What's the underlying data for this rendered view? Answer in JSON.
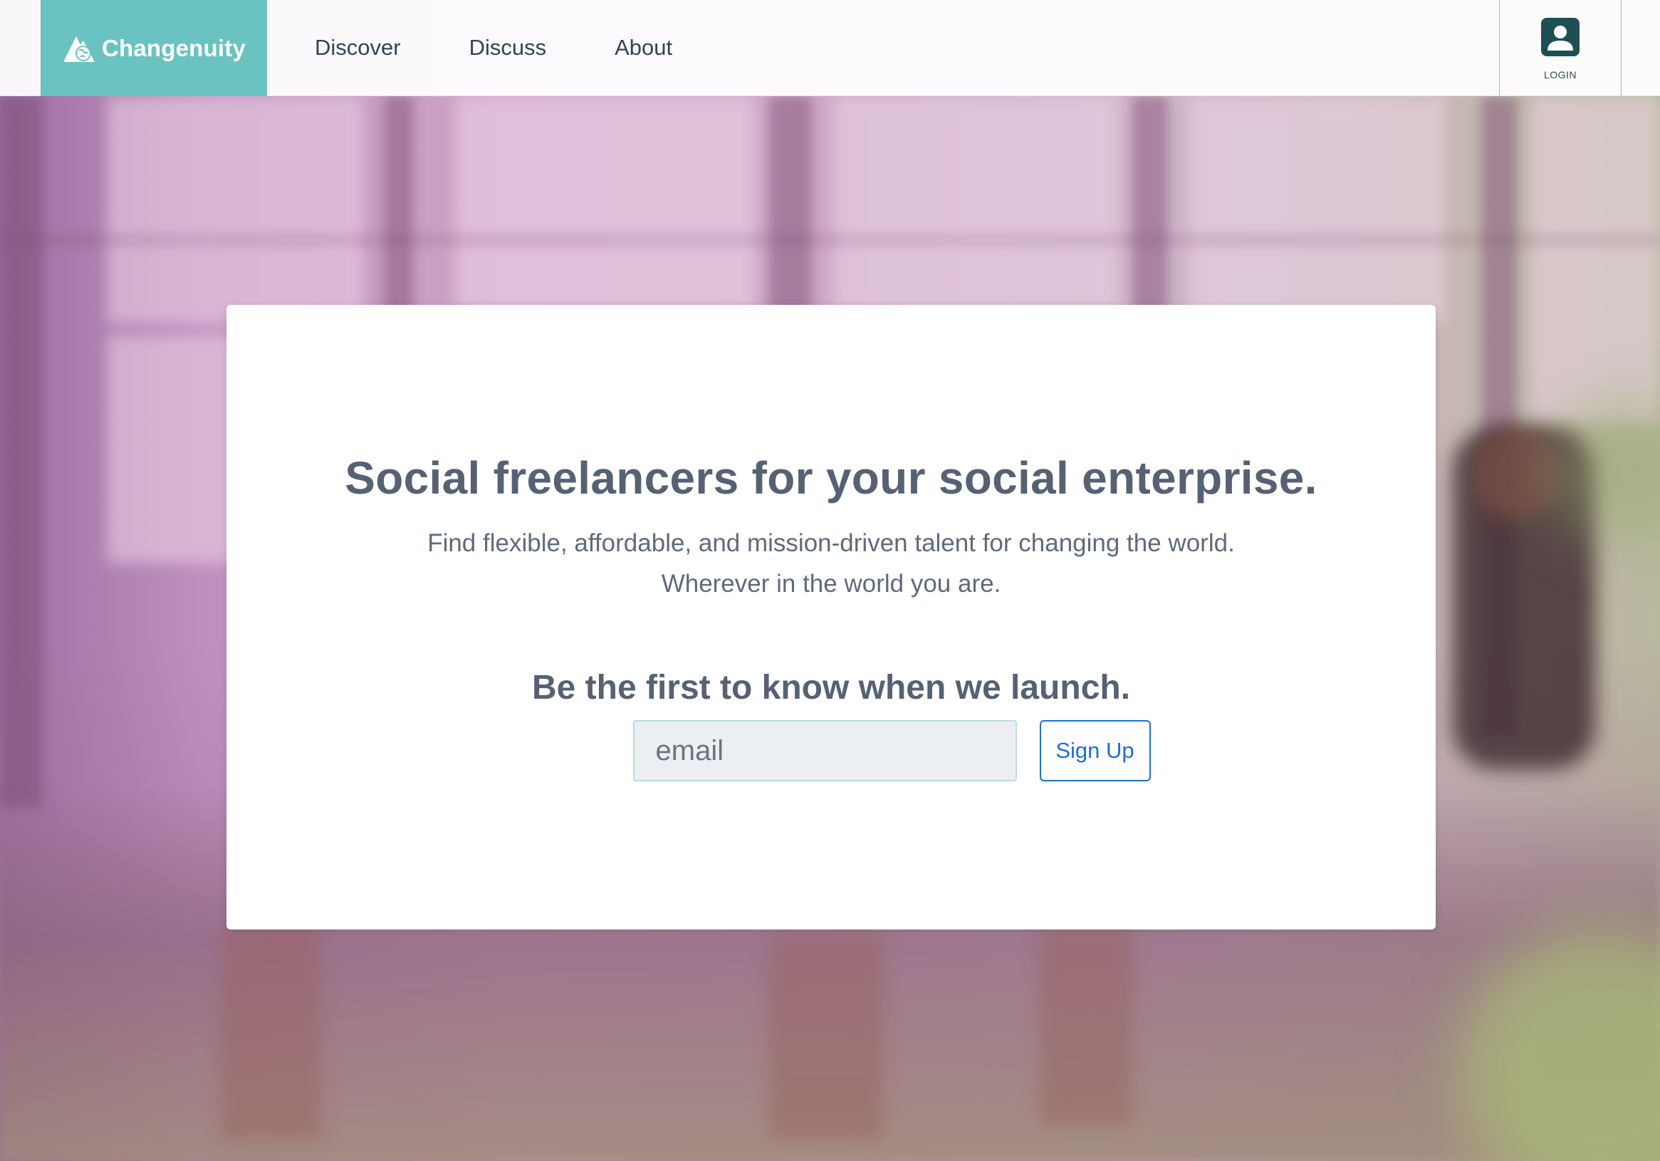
{
  "header": {
    "brand": "Changenuity",
    "nav": [
      {
        "label": "Discover"
      },
      {
        "label": "Discuss"
      },
      {
        "label": "About"
      }
    ],
    "login_label": "LOGIN"
  },
  "hero": {
    "headline": "Social freelancers for your social enterprise.",
    "subline_1": "Find flexible, affordable, and mission-driven talent for changing the world.",
    "subline_2": "Wherever in the world you are.",
    "launch_heading": "Be the first to know when we launch.",
    "email_placeholder": "email",
    "email_value": "",
    "signup_label": "Sign Up"
  },
  "colors": {
    "brand_teal": "#6ac3c0",
    "heading_slate": "#566274",
    "signup_blue": "#1d6fd6",
    "avatar_dark": "#1f4f55"
  },
  "icons": {
    "brand_logo": "mountain-globe-icon",
    "login": "user-avatar-icon"
  }
}
